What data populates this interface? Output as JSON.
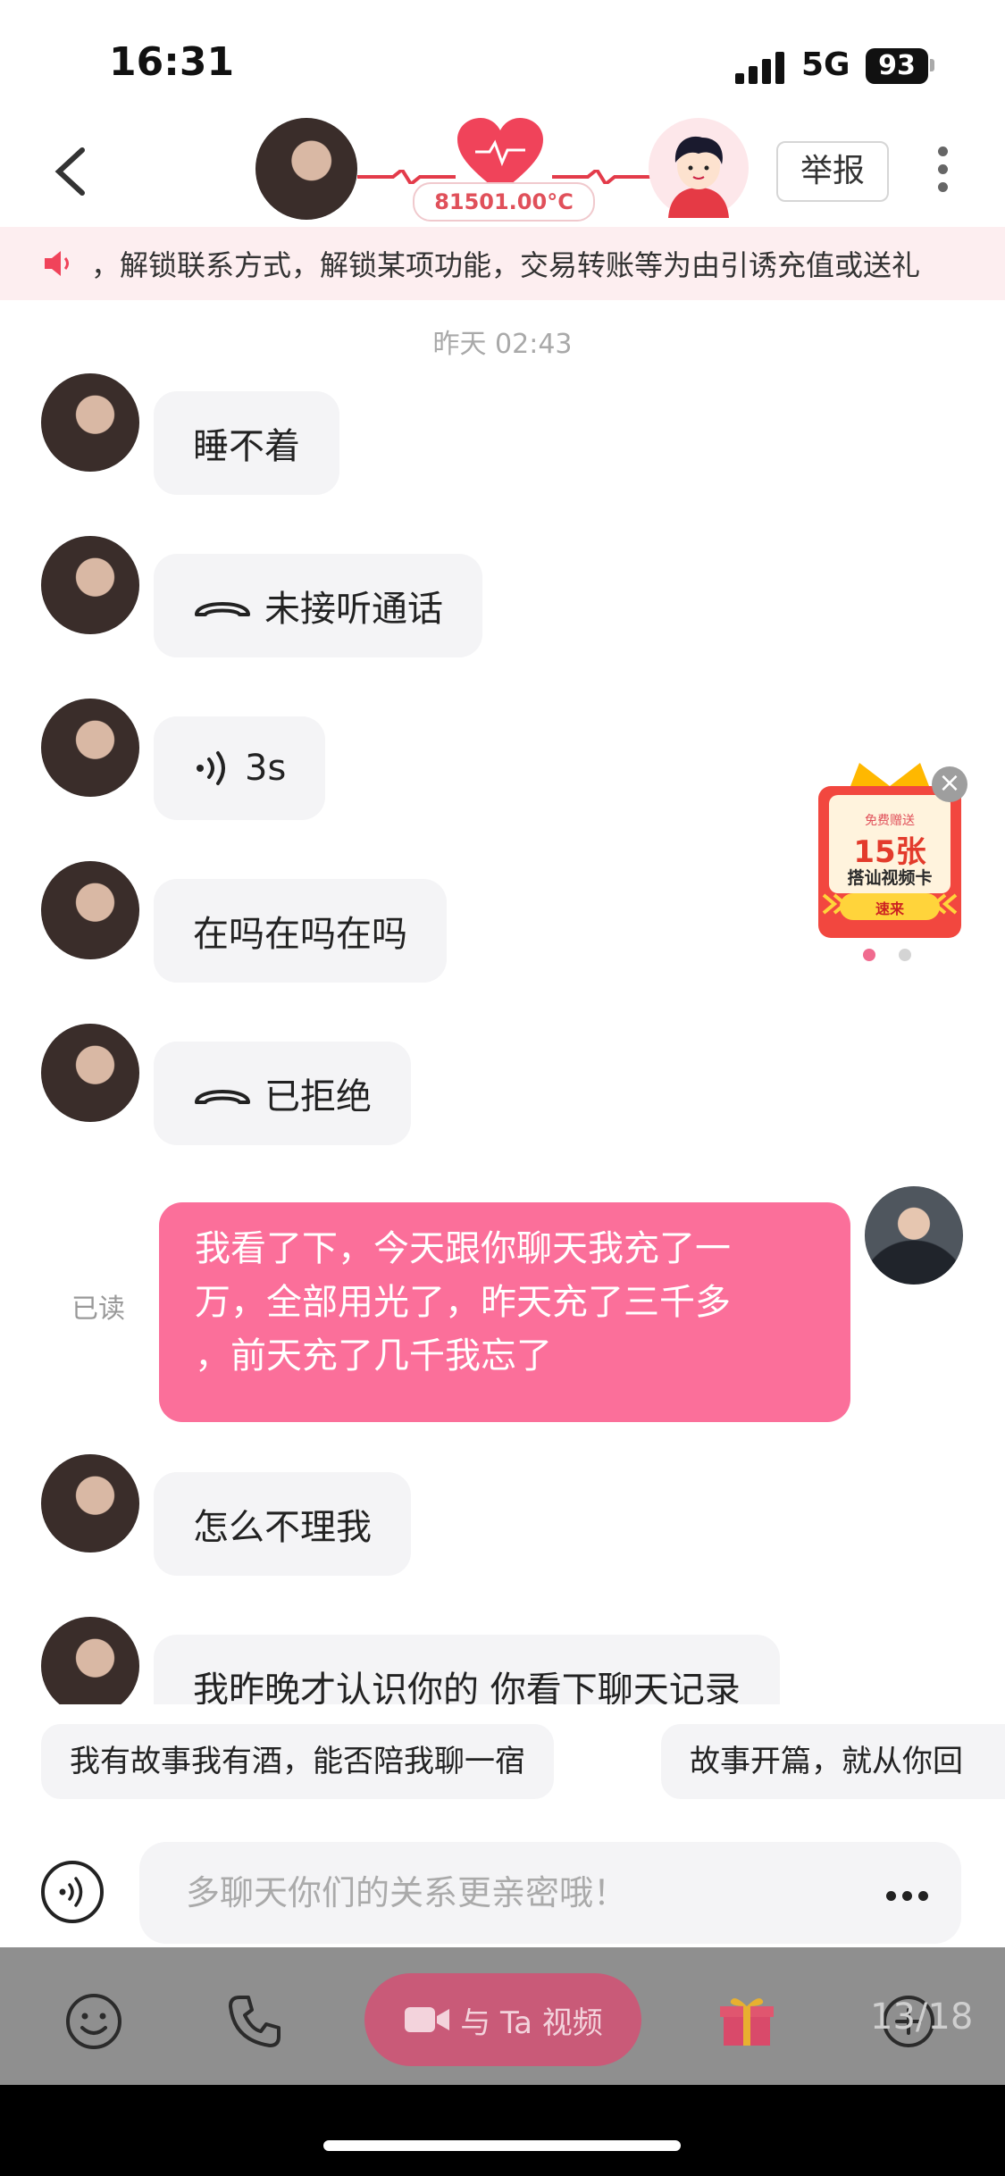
{
  "status_bar": {
    "time": "16:31",
    "network": "5G",
    "battery": "93"
  },
  "header": {
    "temperature": "81501.00°C",
    "report_label": "举报"
  },
  "notice": {
    "text": "，解锁联系方式，解锁某项功能，交易转账等为由引诱充值或送礼"
  },
  "timestamp": "昨天 02:43",
  "messages": [
    {
      "side": "left",
      "type": "text",
      "text": "睡不着"
    },
    {
      "side": "left",
      "type": "call",
      "icon": "phone-hangup-icon",
      "text": "未接听通话"
    },
    {
      "side": "left",
      "type": "voice",
      "icon": "voice-wave-icon",
      "text": "3s"
    },
    {
      "side": "left",
      "type": "text",
      "text": "在吗在吗在吗"
    },
    {
      "side": "left",
      "type": "call",
      "icon": "phone-hangup-icon",
      "text": "已拒绝"
    },
    {
      "side": "right",
      "type": "text",
      "status": "已读",
      "lines": [
        "我看了下，今天跟你聊天我充了一",
        "万，全部用光了，昨天充了三千多",
        "，前天充了几千我忘了"
      ]
    },
    {
      "side": "left",
      "type": "text",
      "text": "怎么不理我"
    },
    {
      "side": "left",
      "type": "text",
      "text": "我昨晚才认识你的 你看下聊天记录"
    }
  ],
  "ad": {
    "top_label": "免费赠送",
    "count": "15张",
    "title": "搭讪视频卡",
    "button": "速来",
    "close": "×"
  },
  "quick_replies": [
    "我有故事我有酒，能否陪我聊一宿",
    "故事开篇，就从你回"
  ],
  "input": {
    "placeholder": "多聊天你们的关系更亲密哦！"
  },
  "bottom_bar": {
    "video_label": "与 Ta 视频",
    "page": "13/18"
  },
  "colors": {
    "accent_pink": "#fb6f9a",
    "notice_bg": "#fdeef0",
    "bubble_gray": "#f4f4f6"
  }
}
